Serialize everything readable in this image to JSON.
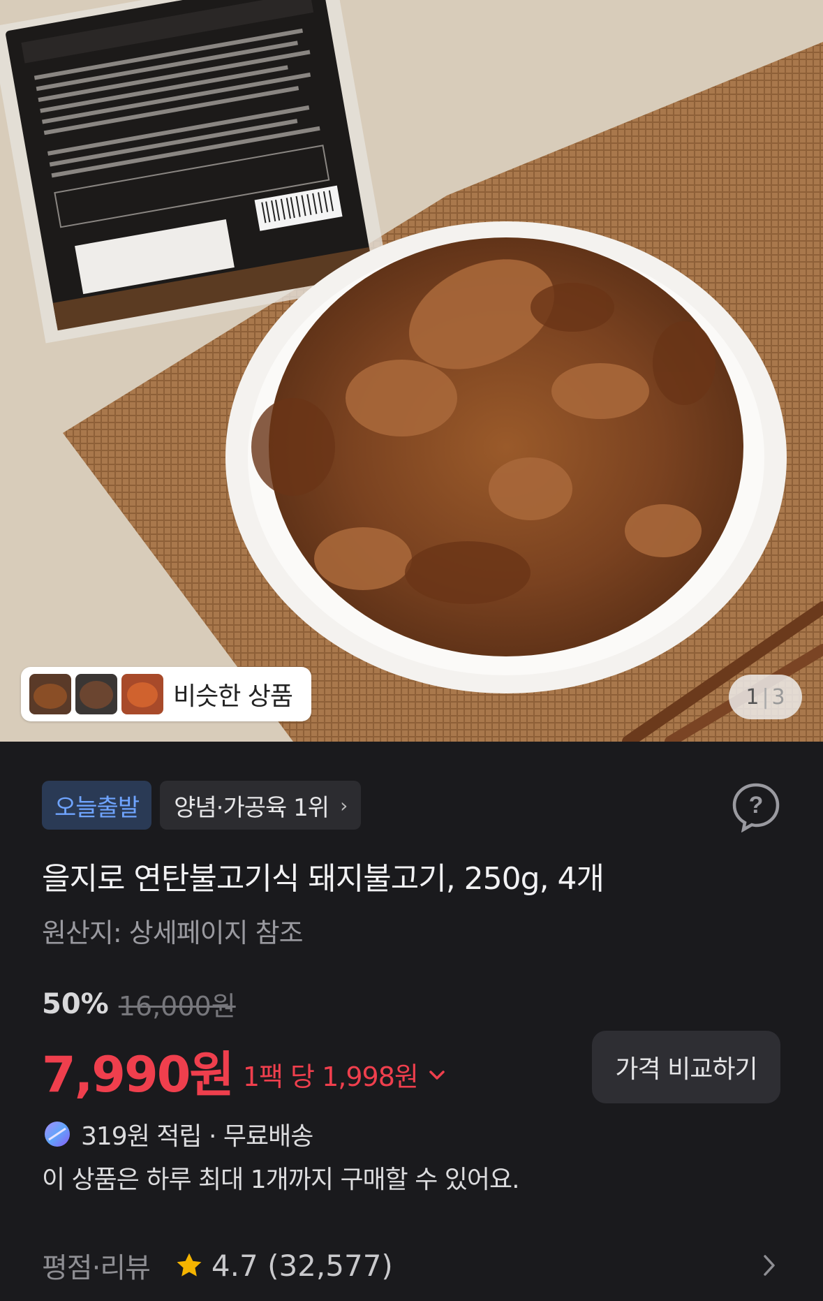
{
  "hero": {
    "similar_label": "비슷한 상품",
    "pager_current": "1",
    "pager_total": "3"
  },
  "badges": {
    "today": "오늘출발",
    "rank": "양념·가공육 1위"
  },
  "product": {
    "title": "을지로 연탄불고기식 돼지불고기, 250g, 4개",
    "origin": "원산지: 상세페이지 참조"
  },
  "pricing": {
    "discount": "50%",
    "original_price": "16,000원",
    "price": "7,990원",
    "unit_price": "1팩 당 1,998원",
    "compare_label": "가격 비교하기"
  },
  "benefits": {
    "reward": "319원 적립 · 무료배송",
    "limit": "이 상품은 하루 최대 1개까지 구매할 수 있어요."
  },
  "review": {
    "label": "평점·리뷰",
    "rating": "4.7 (32,577)"
  },
  "colors": {
    "accent_price": "#ef3f4d",
    "today_badge": "#6fa4ff",
    "star": "#f5b400"
  },
  "icons": [
    "help-icon",
    "chevron-right-icon",
    "chevron-down-icon",
    "reward-icon",
    "star-icon"
  ]
}
